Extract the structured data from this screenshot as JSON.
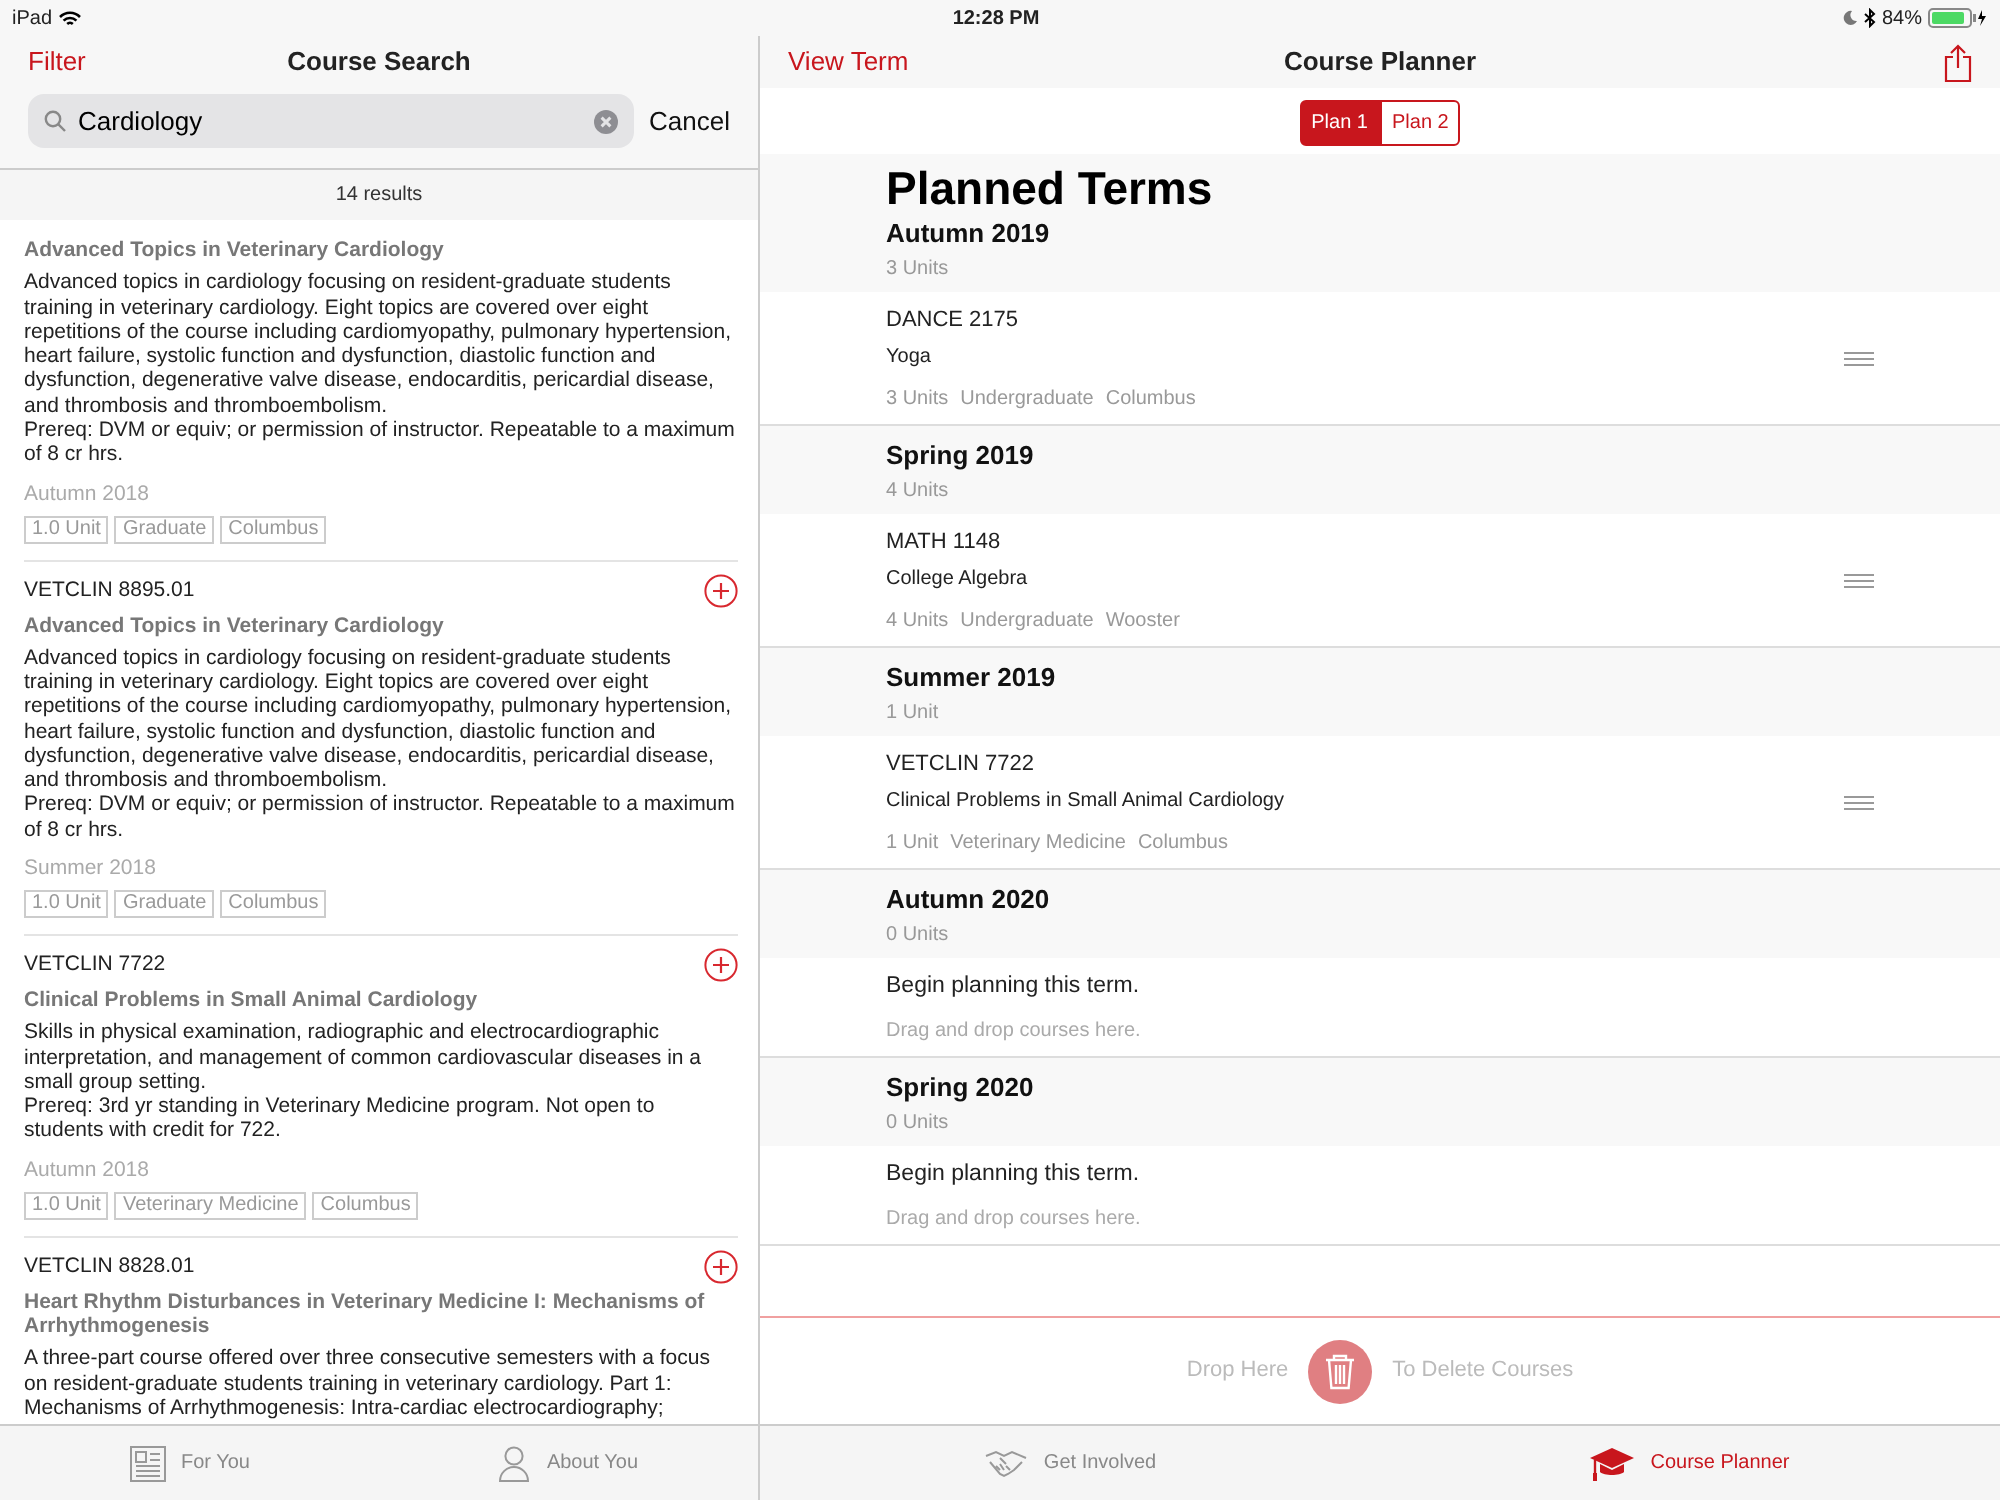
{
  "status_bar": {
    "device": "iPad",
    "time": "12:28 PM",
    "battery": "84%"
  },
  "search_pane": {
    "filter": "Filter",
    "title": "Course Search",
    "search": {
      "value": "Cardiology"
    },
    "cancel": "Cancel",
    "results_count": "14 results",
    "courses": [
      {
        "add_button": false,
        "title": "Advanced Topics in Veterinary Cardiology",
        "description": "Advanced topics in cardiology focusing on resident-graduate students training in veterinary cardiology. Eight topics are covered over eight repetitions of the course including cardiomyopathy, pulmonary hypertension, heart failure, systolic function and dysfunction, diastolic function and dysfunction, degenerative valve disease, endocarditis, pericardial disease, and thrombosis and thromboembolism.",
        "prereq": "Prereq: DVM or equiv; or permission of instructor. Repeatable to a maximum of 8 cr hrs.",
        "term": "Autumn 2018",
        "tags": [
          "1.0 Unit",
          "Graduate",
          "Columbus"
        ]
      },
      {
        "add_button": true,
        "code": "VETCLIN 8895.01",
        "title": "Advanced Topics in Veterinary Cardiology",
        "description": "Advanced topics in cardiology focusing on resident-graduate students training in veterinary cardiology. Eight topics are covered over eight repetitions of the course including cardiomyopathy, pulmonary hypertension, heart failure, systolic function and dysfunction, diastolic function and dysfunction, degenerative valve disease, endocarditis, pericardial disease, and thrombosis and thromboembolism.",
        "prereq": "Prereq: DVM or equiv; or permission of instructor. Repeatable to a maximum of 8 cr hrs.",
        "term": "Summer 2018",
        "tags": [
          "1.0 Unit",
          "Graduate",
          "Columbus"
        ]
      },
      {
        "add_button": true,
        "code": "VETCLIN 7722",
        "title": "Clinical Problems in Small Animal Cardiology",
        "description": "Skills in physical examination, radiographic and electrocardiographic interpretation, and management of common cardiovascular diseases in a small group setting.",
        "prereq": "Prereq: 3rd yr standing in Veterinary Medicine program. Not open to students with credit for 722.",
        "term": "Autumn 2018",
        "tags": [
          "1.0 Unit",
          "Veterinary Medicine",
          "Columbus"
        ]
      },
      {
        "add_button": true,
        "code": "VETCLIN 8828.01",
        "title": "Heart Rhythm Disturbances in Veterinary Medicine I: Mechanisms of Arrhythmogenesis",
        "description": "A three-part course offered over three consecutive semesters with a focus on resident-graduate students training in veterinary cardiology. Part 1: Mechanisms of Arrhythmogenesis: Intra-cardiac electrocardiography;"
      }
    ]
  },
  "planner": {
    "view_term": "View Term",
    "title": "Course Planner",
    "plans": [
      {
        "label": "Plan 1",
        "selected": true
      },
      {
        "label": "Plan 2",
        "selected": false
      }
    ],
    "heading": "Planned Terms",
    "terms": [
      {
        "name": "Autumn 2019",
        "units": "3 Units",
        "courses": [
          {
            "code": "DANCE 2175",
            "title": "Yoga",
            "details": [
              "3 Units",
              "Undergraduate",
              "Columbus"
            ]
          }
        ]
      },
      {
        "name": "Spring 2019",
        "units": "4 Units",
        "courses": [
          {
            "code": "MATH 1148",
            "title": "College Algebra",
            "details": [
              "4 Units",
              "Undergraduate",
              "Wooster"
            ]
          }
        ]
      },
      {
        "name": "Summer 2019",
        "units": "1 Unit",
        "courses": [
          {
            "code": "VETCLIN 7722",
            "title": "Clinical Problems in Small Animal Cardiology",
            "details": [
              "1 Unit",
              "Veterinary Medicine",
              "Columbus"
            ]
          }
        ]
      },
      {
        "name": "Autumn 2020",
        "units": "0 Units",
        "empty": {
          "title": "Begin planning this term.",
          "hint": "Drag and drop courses here."
        }
      },
      {
        "name": "Spring 2020",
        "units": "0 Units",
        "empty": {
          "title": "Begin planning this term.",
          "hint": "Drag and drop courses here."
        }
      }
    ],
    "delete_zone": {
      "before": "Drop Here",
      "after": "To Delete Courses"
    }
  },
  "tab_bar": [
    {
      "label": "For You",
      "selected": false
    },
    {
      "label": "About You",
      "selected": false
    },
    {
      "label": "Get Involved",
      "selected": false
    },
    {
      "label": "Course Planner",
      "selected": true
    }
  ]
}
